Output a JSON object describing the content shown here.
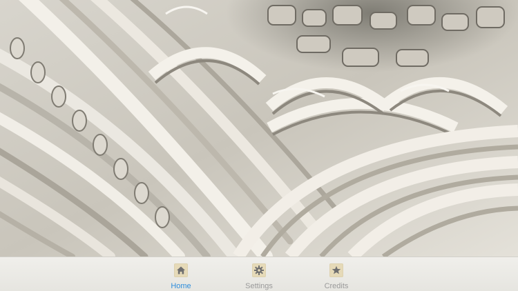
{
  "hero": {
    "image_name": "ornate-fractal-arches-image"
  },
  "tabs": [
    {
      "label": "Home",
      "icon": "home-icon",
      "active": true
    },
    {
      "label": "Settings",
      "icon": "gear-icon",
      "active": false
    },
    {
      "label": "Credits",
      "icon": "star-icon",
      "active": false
    }
  ],
  "colors": {
    "active_tab": "#2f8edc",
    "inactive_tab": "#9a9a9a",
    "tabbar_background": "#ece9e2",
    "icon_tile": "#e6dab8",
    "icon_glyph": "#6f6f6f"
  }
}
